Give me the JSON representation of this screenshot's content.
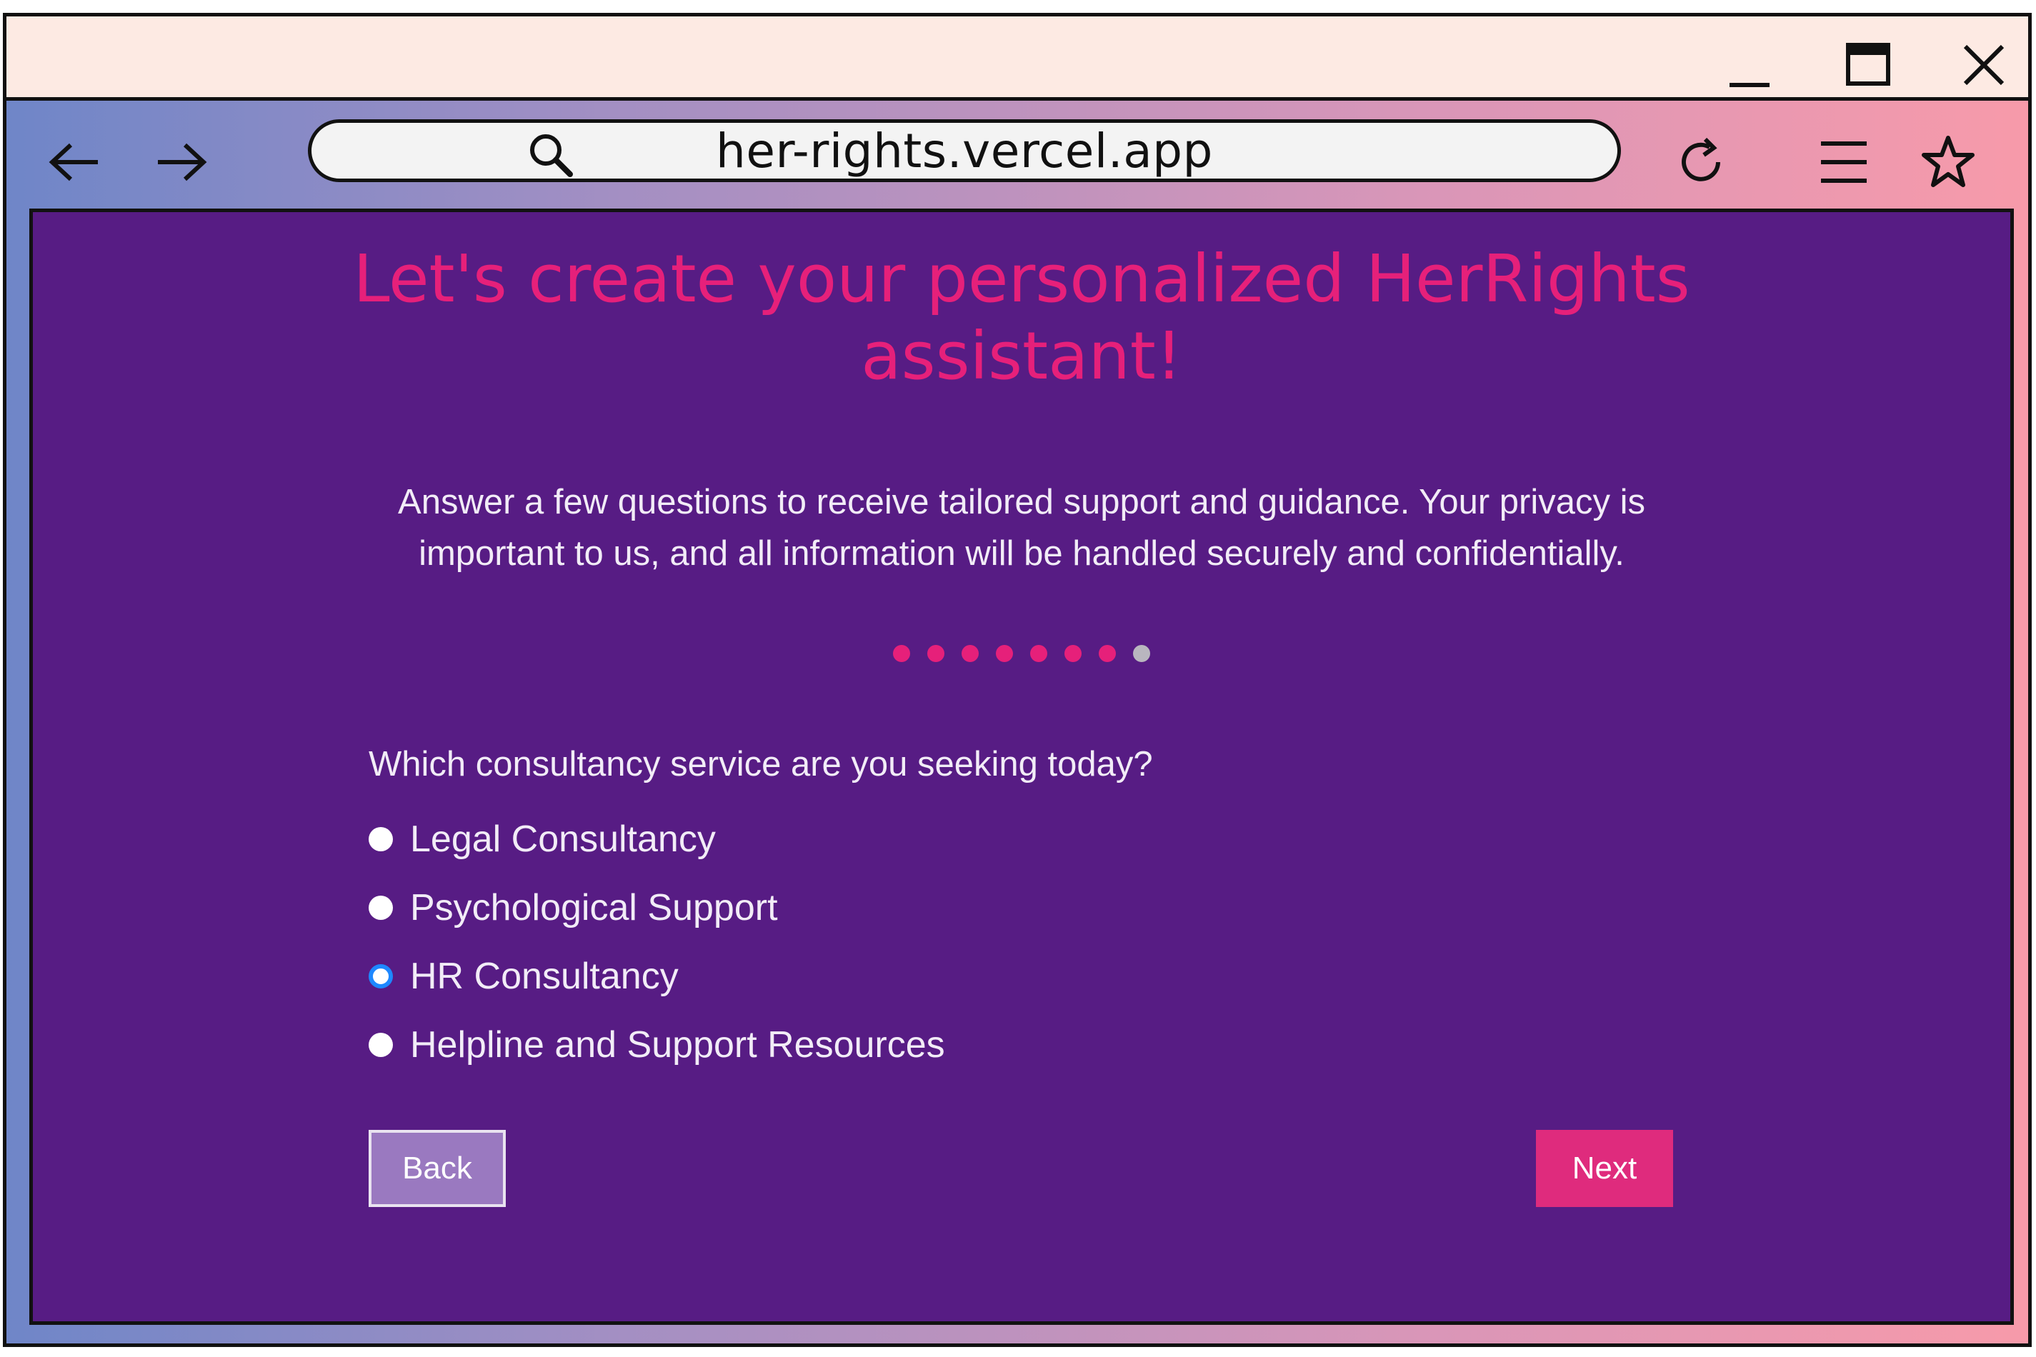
{
  "browser": {
    "url": "her-rights.vercel.app"
  },
  "page": {
    "title": "Let's create your personalized HerRights assistant!",
    "subtitle": "Answer a few questions to receive tailored support and guidance. Your privacy is important to us, and all information will be handled securely and confidentially.",
    "progress": {
      "total_steps": 8,
      "current_step": 8
    },
    "question": "Which consultancy service are you seeking today?",
    "options": [
      {
        "label": "Legal Consultancy",
        "selected": false
      },
      {
        "label": "Psychological Support",
        "selected": false
      },
      {
        "label": "HR Consultancy",
        "selected": true
      },
      {
        "label": "Helpline and Support Resources",
        "selected": false
      }
    ],
    "back_label": "Back",
    "next_label": "Next"
  },
  "colors": {
    "content_bg": "#571c84",
    "title": "#e6207a",
    "accent": "#df2b7d",
    "radio_selected": "#1e88ff"
  }
}
